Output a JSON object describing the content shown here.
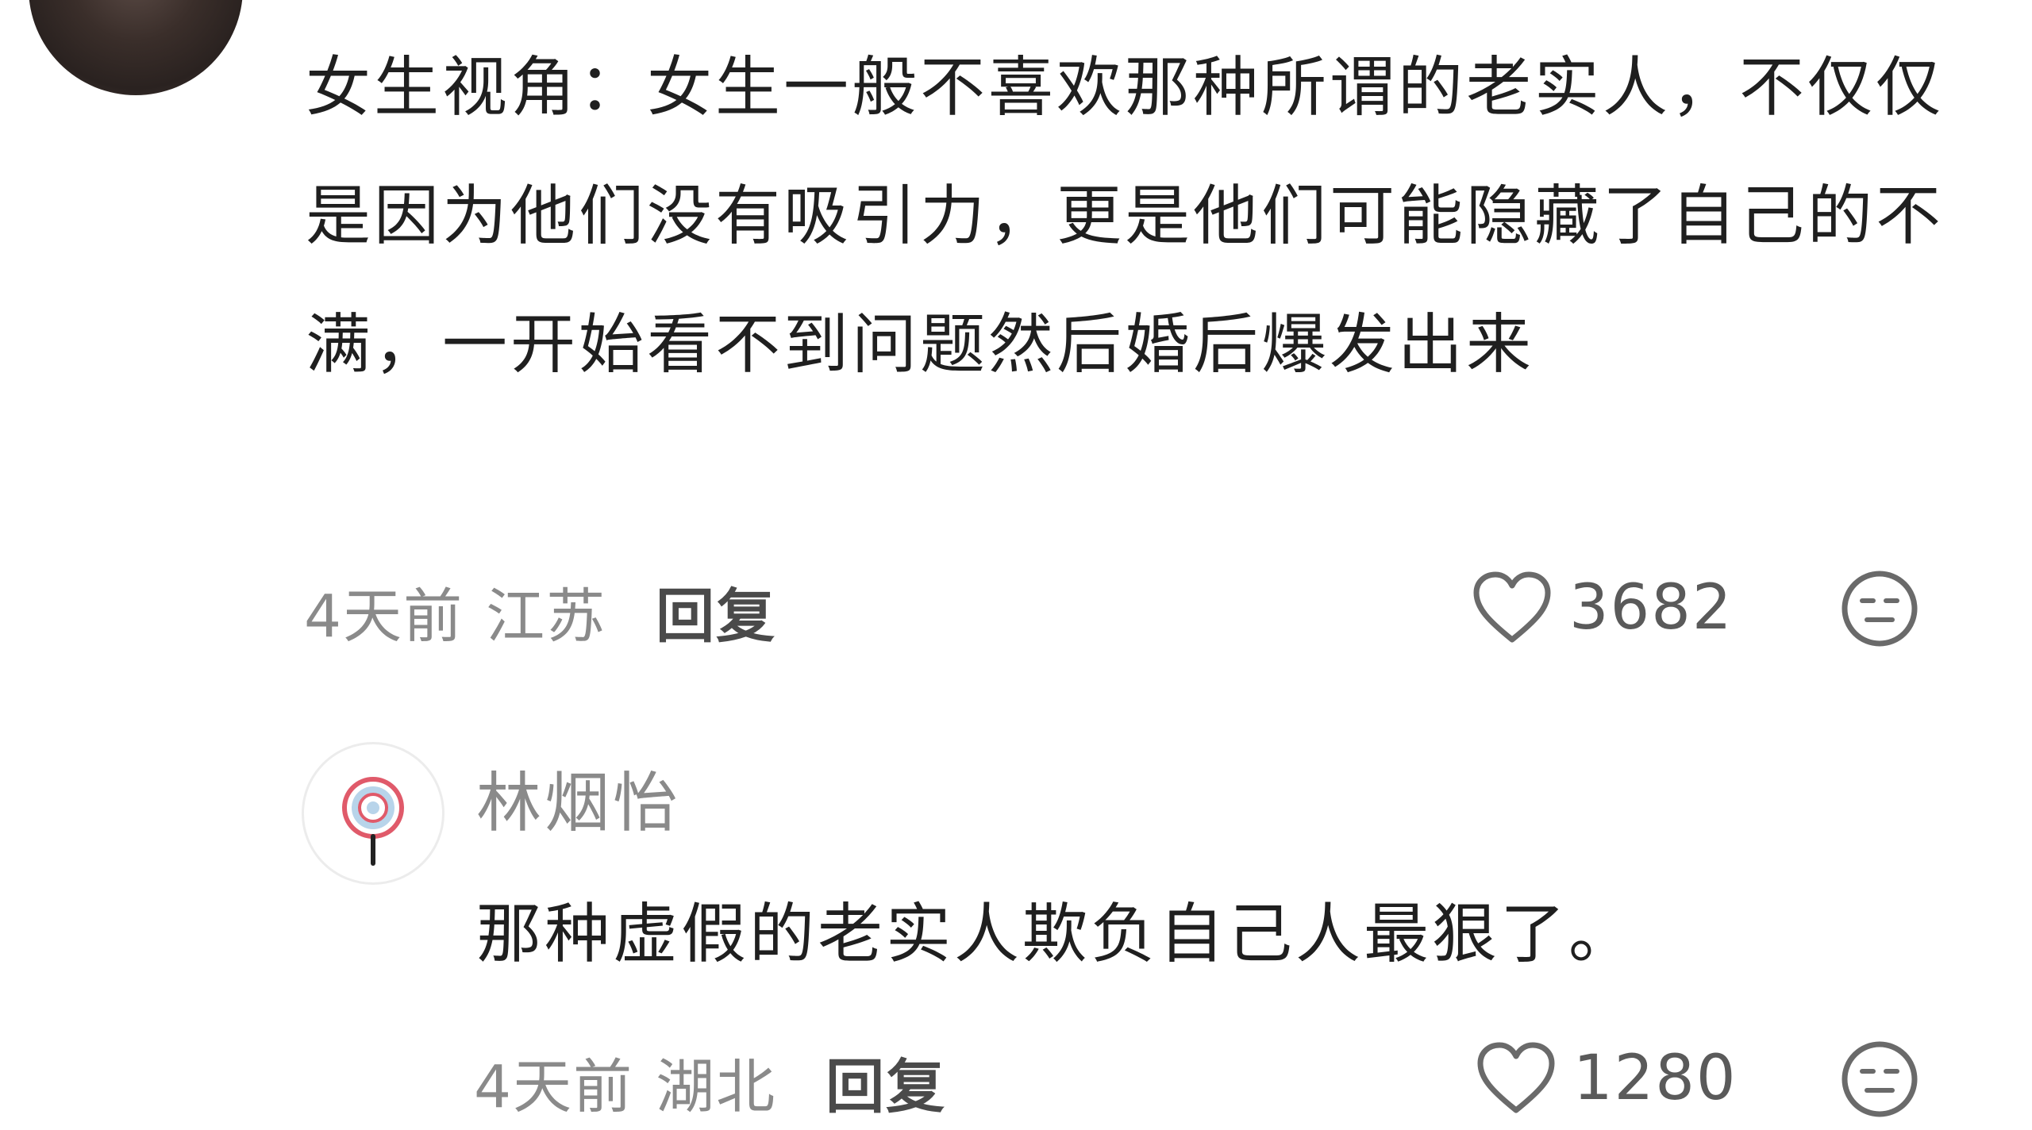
{
  "comment": {
    "text": "女生视角：女生一般不喜欢那种所谓的老实人，不仅仅是因为他们没有吸引力，更是他们可能隐藏了自己的不满，一开始看不到问题然后婚后爆发出来",
    "time": "4天前",
    "location": "江苏",
    "reply_label": "回复",
    "likes": "3682",
    "like_icon": "heart-outline-icon",
    "emoji_icon": "neutral-face-icon"
  },
  "reply": {
    "username": "林烟怡",
    "text": "那种虚假的老实人欺负自己人最狠了。",
    "time": "4天前",
    "location": "湖北",
    "reply_label": "回复",
    "likes": "1280",
    "like_icon": "heart-outline-icon",
    "emoji_icon": "neutral-face-icon"
  },
  "colors": {
    "text_primary": "#1f1f1f",
    "text_secondary": "#8a8a8a",
    "icon_gray": "#6a6a6a",
    "avatar_ring": "#e05a6a"
  }
}
